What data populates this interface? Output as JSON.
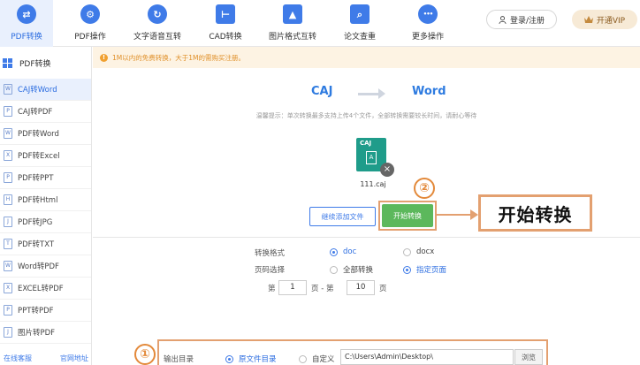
{
  "toolbar": {
    "items": [
      {
        "label": "PDF转换",
        "icon": "⇄"
      },
      {
        "label": "PDF操作",
        "icon": "⚙"
      },
      {
        "label": "文字语音互转",
        "icon": "↻"
      },
      {
        "label": "CAD转换",
        "icon": "⊢"
      },
      {
        "label": "图片格式互转",
        "icon": "▲"
      },
      {
        "label": "论文查重",
        "icon": "⌕"
      },
      {
        "label": "更多操作",
        "icon": "•••"
      }
    ],
    "login_label": "登录/注册",
    "vip_label": "开通VIP"
  },
  "sidebar": {
    "header": "PDF转换",
    "items": [
      {
        "label": "CAJ转Word",
        "icon": "W"
      },
      {
        "label": "CAJ转PDF",
        "icon": "P"
      },
      {
        "label": "PDF转Word",
        "icon": "W"
      },
      {
        "label": "PDF转Excel",
        "icon": "X"
      },
      {
        "label": "PDF转PPT",
        "icon": "P"
      },
      {
        "label": "PDF转Html",
        "icon": "H"
      },
      {
        "label": "PDF转JPG",
        "icon": "J"
      },
      {
        "label": "PDF转TXT",
        "icon": "T"
      },
      {
        "label": "Word转PDF",
        "icon": "W"
      },
      {
        "label": "EXCEL转PDF",
        "icon": "X"
      },
      {
        "label": "PPT转PDF",
        "icon": "P"
      },
      {
        "label": "图片转PDF",
        "icon": "J"
      }
    ],
    "footer_left": "在线客服",
    "footer_right": "官网地址"
  },
  "notice": "1M以内的免费转换，大于1M的需购买注册。",
  "conversion": {
    "from": "CAJ",
    "to": "Word",
    "hint": "温馨提示：单次转换最多支持上传4个文件，全部转换需要较长时间，请耐心等待"
  },
  "file": {
    "type_label": "CAJ",
    "glyph": "A",
    "name": "111.caj",
    "close": "×"
  },
  "buttons": {
    "add": "继续添加文件",
    "start": "开始转换"
  },
  "annotations": {
    "step1": "①",
    "step2": "②",
    "callout": "开始转换"
  },
  "options": {
    "format_label": "转换格式",
    "format_doc": "doc",
    "format_docx": "docx",
    "pages_label": "页码选择",
    "pages_all": "全部转换",
    "pages_specify": "指定页面",
    "page_prefix": "第",
    "page_from": "1",
    "page_mid": "页 - 第",
    "page_to": "10",
    "page_suffix": "页"
  },
  "output": {
    "label": "输出目录",
    "original_dir": "原文件目录",
    "custom": "自定义",
    "path": "C:\\Users\\Admin\\Desktop\\",
    "browse": "浏览"
  }
}
